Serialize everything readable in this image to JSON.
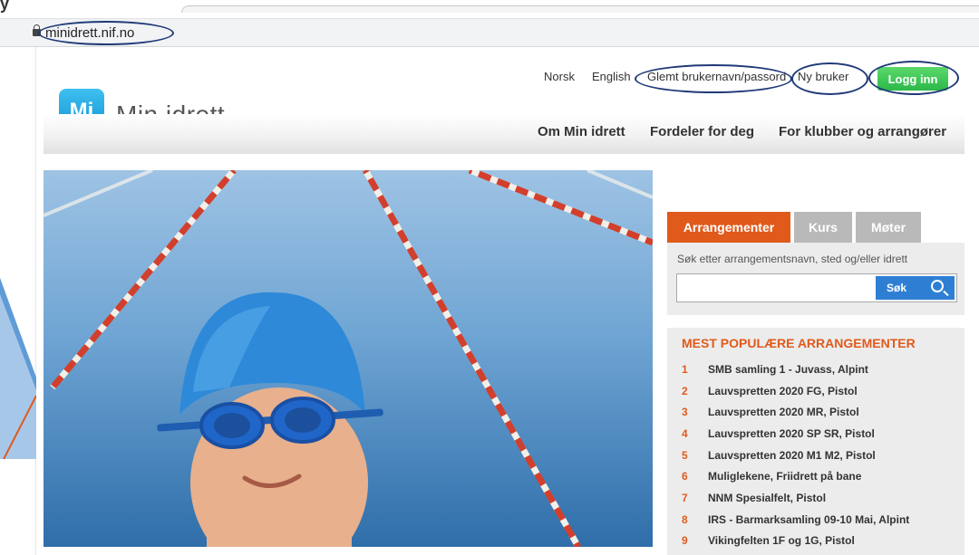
{
  "browser": {
    "title_fragment": "y",
    "url": "minidrett.nif.no",
    "lock_icon": "lock-icon"
  },
  "site": {
    "logo_badge": "Mi",
    "logo_text": "Min idrett"
  },
  "utility_nav": {
    "norsk": "Norsk",
    "english": "English",
    "forgot": "Glemt brukernavn/passord",
    "new_user": "Ny bruker",
    "login": "Logg inn"
  },
  "main_nav": [
    "Om Min idrett",
    "Fordeler for deg",
    "For klubber og arrangører"
  ],
  "search": {
    "tabs": [
      {
        "label": "Arrangementer",
        "active": true
      },
      {
        "label": "Kurs",
        "active": false
      },
      {
        "label": "Møter",
        "active": false
      }
    ],
    "label": "Søk etter arrangementsnavn, sted og/eller idrett",
    "input_value": "",
    "button_label": "Søk",
    "button_icon": "search-icon"
  },
  "popular": {
    "title": "MEST POPULÆRE ARRANGEMENTER",
    "items": [
      {
        "num": "1",
        "text": "SMB samling 1 - Juvass, Alpint"
      },
      {
        "num": "2",
        "text": "Lauvspretten 2020 FG, Pistol"
      },
      {
        "num": "3",
        "text": "Lauvspretten 2020 MR, Pistol"
      },
      {
        "num": "4",
        "text": "Lauvspretten 2020 SP SR, Pistol"
      },
      {
        "num": "5",
        "text": "Lauvspretten 2020 M1 M2, Pistol"
      },
      {
        "num": "6",
        "text": "Muliglekene, Friidrett på bane"
      },
      {
        "num": "7",
        "text": "NNM Spesialfelt, Pistol"
      },
      {
        "num": "8",
        "text": "IRS - Barmarksamling 09-10 Mai, Alpint"
      },
      {
        "num": "9",
        "text": "Vikingfelten 1F og 1G, Pistol"
      }
    ]
  },
  "colors": {
    "accent_orange": "#e05a1c",
    "login_green": "#2bb84a",
    "search_blue": "#2e7fd4",
    "annotation_navy": "#1f3a78",
    "logo_blue": "#1291d4"
  }
}
